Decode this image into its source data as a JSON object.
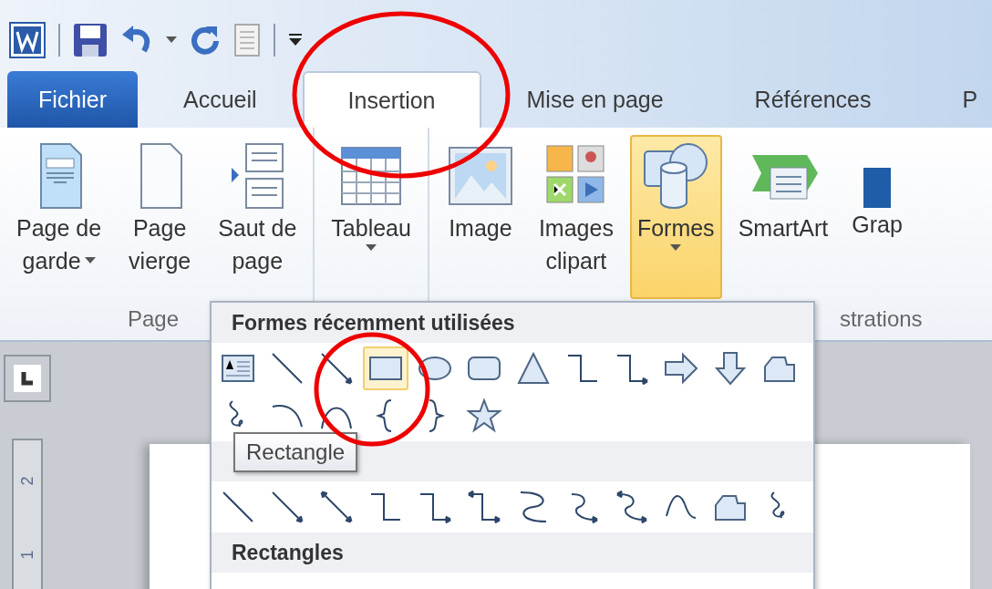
{
  "tabs": [
    {
      "label": "Fichier",
      "kind": "file",
      "selected": false
    },
    {
      "label": "Accueil",
      "kind": "tab",
      "selected": false
    },
    {
      "label": "Insertion",
      "kind": "tab",
      "selected": true
    },
    {
      "label": "Mise en page",
      "kind": "tab",
      "selected": false
    },
    {
      "label": "Références",
      "kind": "tab",
      "selected": false
    },
    {
      "label": "P",
      "kind": "tab",
      "selected": false
    }
  ],
  "ribbon": {
    "groups": [
      {
        "label": "Page",
        "buttons": [
          {
            "kind": "cover-page",
            "lines": [
              "Page de",
              "garde"
            ],
            "dropdown": true,
            "selected": false
          },
          {
            "kind": "blank-page",
            "lines": [
              "Page",
              "vierge"
            ],
            "dropdown": false,
            "selected": false
          },
          {
            "kind": "page-break",
            "lines": [
              "Saut de",
              "page"
            ],
            "dropdown": false,
            "selected": false
          }
        ]
      },
      {
        "buttons": [
          {
            "kind": "table",
            "lines": [
              "Tableau"
            ],
            "dropdown": true,
            "selected": false
          }
        ]
      },
      {
        "label": "strations",
        "buttons": [
          {
            "kind": "picture",
            "lines": [
              "Image"
            ],
            "dropdown": false,
            "selected": false
          },
          {
            "kind": "clipart",
            "lines": [
              "Images",
              "clipart"
            ],
            "dropdown": false,
            "selected": false
          },
          {
            "kind": "shapes",
            "lines": [
              "Formes"
            ],
            "dropdown": true,
            "selected": true
          },
          {
            "kind": "smartart",
            "lines": [
              "SmartArt"
            ],
            "dropdown": false,
            "selected": false
          },
          {
            "kind": "chart",
            "lines": [
              "Grap"
            ],
            "dropdown": false,
            "selected": false
          }
        ]
      }
    ]
  },
  "ruler": {
    "numbers": [
      "2",
      "1"
    ]
  },
  "shapes_menu": {
    "sections": [
      {
        "title": "Formes récemment utilisées",
        "shapes": [
          {
            "kind": "textbox",
            "selected": false
          },
          {
            "kind": "line",
            "selected": false
          },
          {
            "kind": "arrow",
            "selected": false
          },
          {
            "kind": "rectangle",
            "selected": true
          },
          {
            "kind": "oval",
            "selected": false
          },
          {
            "kind": "rounded-rectangle",
            "selected": false
          },
          {
            "kind": "triangle",
            "selected": false
          },
          {
            "kind": "elbow",
            "selected": false
          },
          {
            "kind": "elbow-arrow",
            "selected": false
          },
          {
            "kind": "right-arrow",
            "selected": false
          },
          {
            "kind": "down-arrow",
            "selected": false
          },
          {
            "kind": "freeform",
            "selected": false
          },
          {
            "kind": "scribble",
            "selected": false
          },
          {
            "kind": "curve",
            "selected": false
          },
          {
            "kind": "arc",
            "selected": false
          },
          {
            "kind": "left-brace",
            "selected": false
          },
          {
            "kind": "right-brace",
            "selected": false
          },
          {
            "kind": "star",
            "selected": false
          }
        ]
      },
      {
        "shapes": [
          {
            "kind": "line",
            "selected": false
          },
          {
            "kind": "arrow",
            "selected": false
          },
          {
            "kind": "double-arrow",
            "selected": false
          },
          {
            "kind": "elbow",
            "selected": false
          },
          {
            "kind": "elbow-arrow",
            "selected": false
          },
          {
            "kind": "elbow-double-arrow",
            "selected": false
          },
          {
            "kind": "curve-s",
            "selected": false
          },
          {
            "kind": "curve-arrow",
            "selected": false
          },
          {
            "kind": "curve-double-arrow",
            "selected": false
          },
          {
            "kind": "wave",
            "selected": false
          },
          {
            "kind": "freeform",
            "selected": false
          },
          {
            "kind": "scribble",
            "selected": false
          }
        ]
      },
      {
        "title": "Rectangles"
      }
    ],
    "tooltip": "Rectangle"
  }
}
